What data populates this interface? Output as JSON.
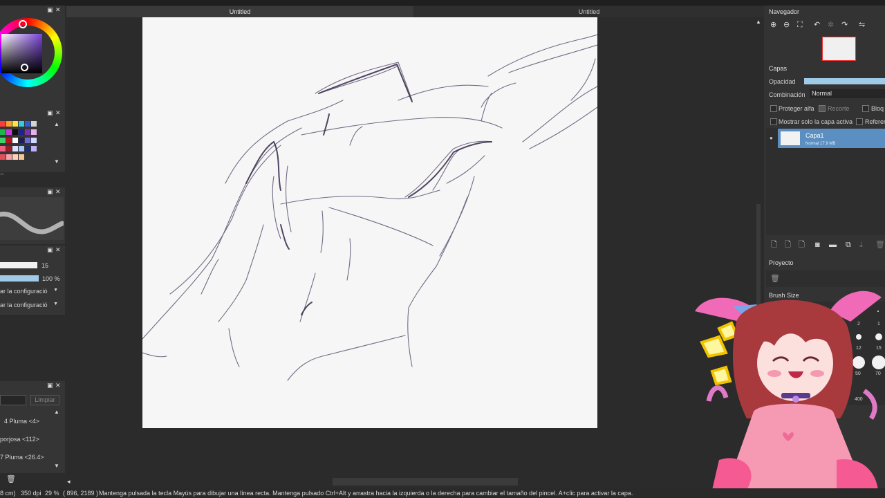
{
  "colors": {
    "accent": "#4f8fcf",
    "layer_selected": "#5b8fc2",
    "opacity_bar": "#9fcbe8"
  },
  "tabs": [
    {
      "label": "Untitled"
    },
    {
      "label": "Untitled"
    }
  ],
  "left_panel": {
    "size_value": "15",
    "opacity_value": "100 %",
    "config1": "ar la configuració",
    "config2": "ar la configuració",
    "clear_button": "Limpiar",
    "brushes": [
      "4 Pluma <4>",
      "porjosa <112>",
      "7 Pluma <26.4>"
    ],
    "dash_text": "--"
  },
  "navigator": {
    "title": "Navegador"
  },
  "layers": {
    "title": "Capas",
    "opacity_label": "Opacidad",
    "blend_label": "Combinación",
    "blend_value": "Normal",
    "protect_alpha": "Proteger alfa",
    "clipping": "Recorte",
    "lock": "Bloq",
    "show_active_only": "Mostrar solo la capa activa",
    "reference": "Referen",
    "layer_name": "Capa1",
    "layer_info": "Normal 17.9 MB"
  },
  "project": {
    "title": "Proyecto"
  },
  "brush_size": {
    "title": "Brush Size",
    "labels": [
      "2",
      "1",
      "12",
      "15",
      "50",
      "70",
      "300",
      "400"
    ]
  },
  "status": {
    "size": "8 cm)",
    "dpi": "350 dpi",
    "zoom": "29 %",
    "coords": "( 896, 2189 )",
    "hint": "Mantenga pulsada la tecla Mayús para dibujar una línea recta. Mantenga pulsado Ctrl+Alt y arrastra hacia la izquierda o la derecha para cambiar el tamaño del pincel. A+clic para activar la capa."
  }
}
